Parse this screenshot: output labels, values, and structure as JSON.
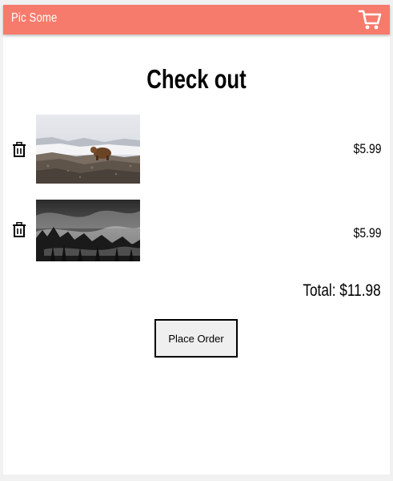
{
  "header": {
    "brand": "Pic Some",
    "cart_icon": "cart-icon"
  },
  "page": {
    "title": "Check out"
  },
  "cart_items": [
    {
      "price": "$5.99",
      "remove_icon": "trash-icon",
      "image_subject": "bear-on-rocky-hillside"
    },
    {
      "price": "$5.99",
      "remove_icon": "trash-icon",
      "image_subject": "misty-forest-mountains-bw"
    }
  ],
  "summary": {
    "total": "Total: $11.98"
  },
  "actions": {
    "place_order_label": "Place Order"
  },
  "colors": {
    "header_bg": "#f67b6c",
    "page_bg": "#ffffff",
    "outer_bg": "#f1f1f1"
  }
}
